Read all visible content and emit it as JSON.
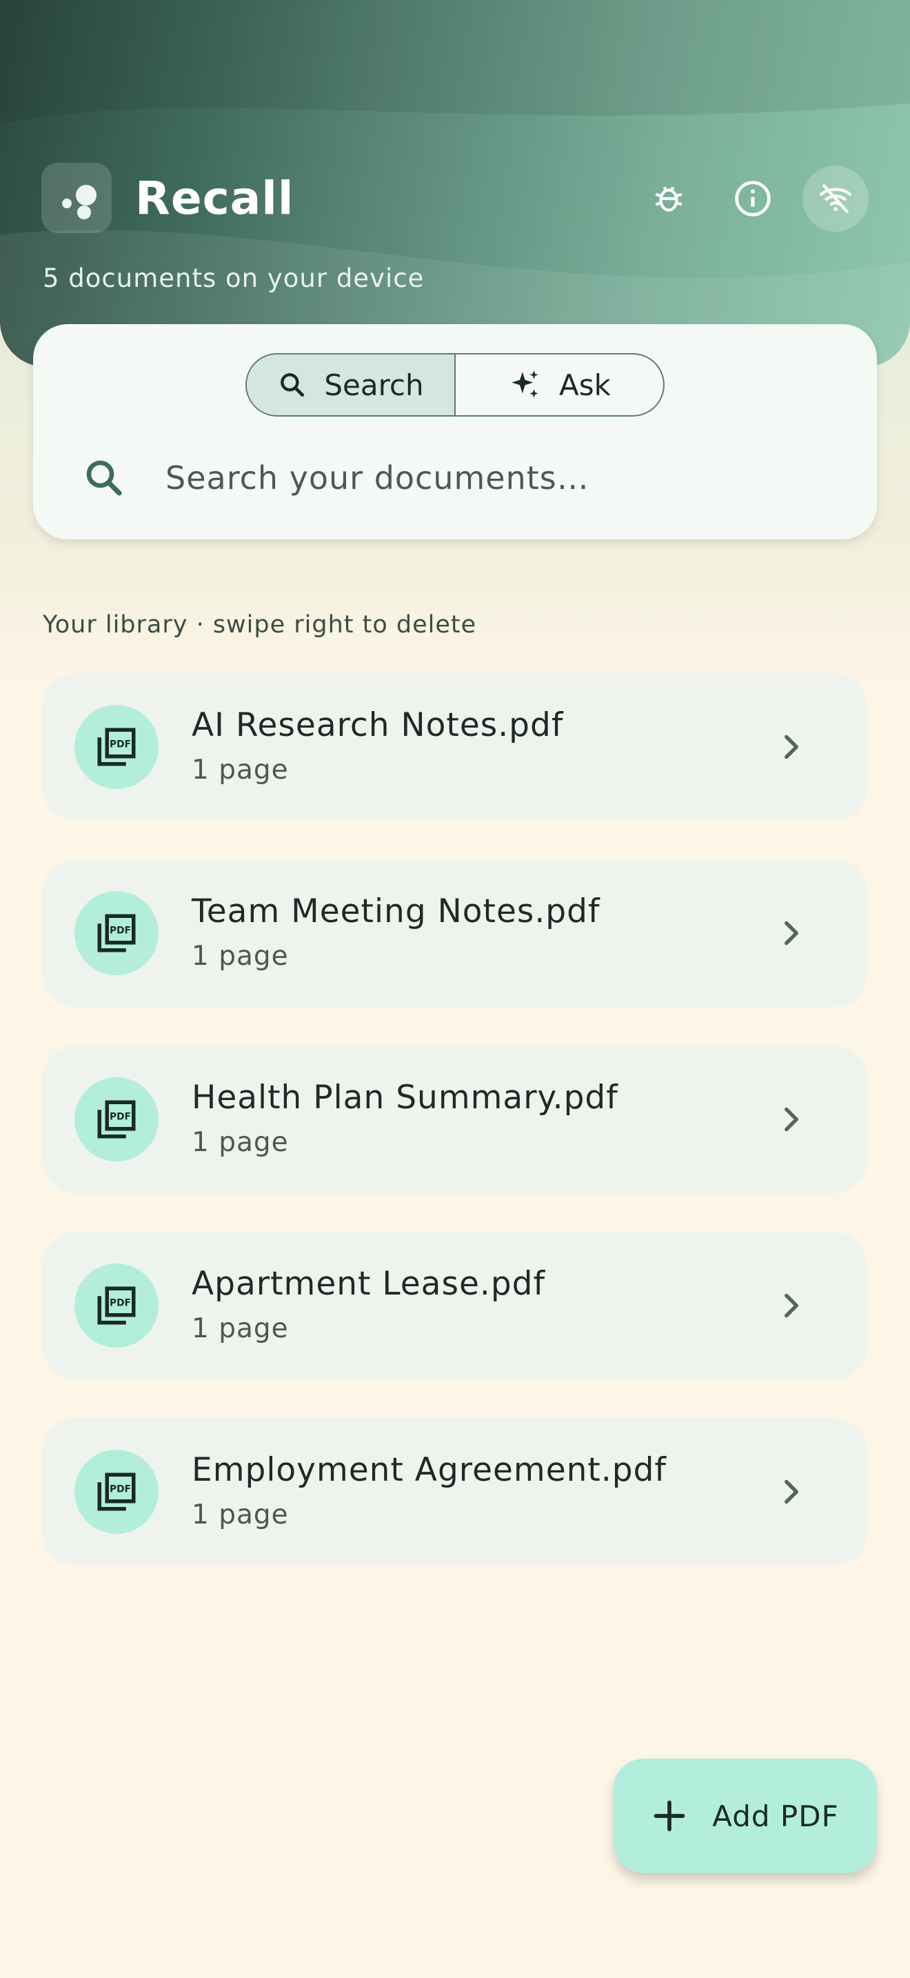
{
  "header": {
    "app_title": "Recall",
    "subtitle": "5 documents on your device",
    "icons": [
      "bug-icon",
      "info-icon",
      "wifi-off-icon"
    ]
  },
  "search": {
    "modes": [
      {
        "label": "Search",
        "icon": "search-icon",
        "active": true
      },
      {
        "label": "Ask",
        "icon": "sparkle-icon",
        "active": false
      }
    ],
    "placeholder": "Search your documents…"
  },
  "library": {
    "label": "Your library · swipe right to delete",
    "documents": [
      {
        "name": "AI Research Notes.pdf",
        "meta": "1 page"
      },
      {
        "name": "Team Meeting Notes.pdf",
        "meta": "1 page"
      },
      {
        "name": "Health Plan Summary.pdf",
        "meta": "1 page"
      },
      {
        "name": "Apartment Lease.pdf",
        "meta": "1 page"
      },
      {
        "name": "Employment Agreement.pdf",
        "meta": "1 page"
      }
    ]
  },
  "fab": {
    "label": "Add PDF",
    "icon": "plus-icon"
  },
  "colors": {
    "header_dark": "#2c4a3f",
    "header_light": "#8fc7ad",
    "accent_mint": "#b2eedb",
    "background": "#fdf5e6"
  }
}
